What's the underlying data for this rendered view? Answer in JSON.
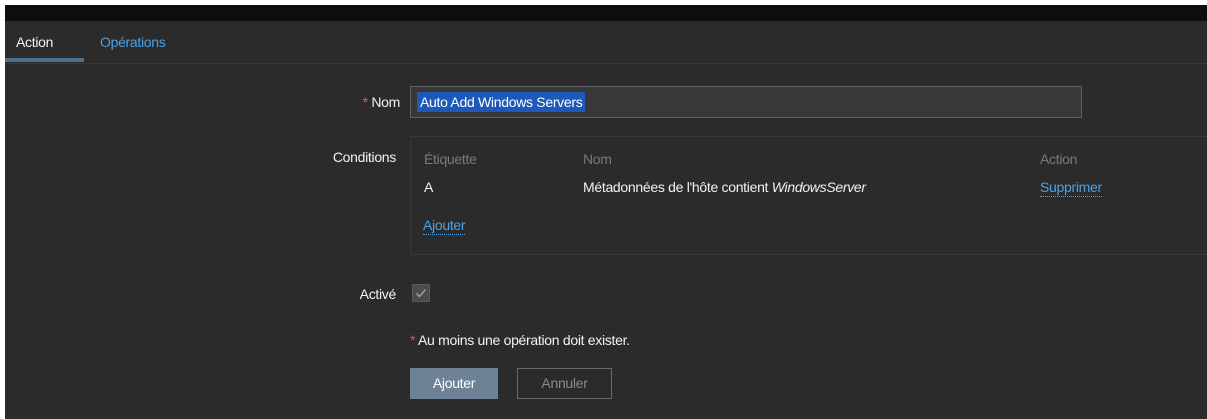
{
  "tabs": [
    {
      "label": "Action",
      "active": true
    },
    {
      "label": "Opérations",
      "active": false
    }
  ],
  "form": {
    "name_label": "Nom",
    "name_value": "Auto Add Windows Servers",
    "conditions_label": "Conditions",
    "enabled_label": "Activé",
    "enabled_checked": true,
    "required_mark": "*"
  },
  "conditions": {
    "headers": {
      "label": "Étiquette",
      "name": "Nom",
      "action": "Action"
    },
    "rows": [
      {
        "label": "A",
        "name_prefix": "Métadonnées de l'hôte contient ",
        "name_value": "WindowsServer",
        "action": "Supprimer"
      }
    ],
    "add_link": "Ajouter"
  },
  "footer": {
    "note": "Au moins une opération doit exister.",
    "add_button": "Ajouter",
    "cancel_button": "Annuler"
  },
  "colors": {
    "background": "#2b2b2b",
    "link": "#4aa3e8",
    "required": "#e45959",
    "primary_button": "#6d8294",
    "selection": "#1e58b8"
  }
}
